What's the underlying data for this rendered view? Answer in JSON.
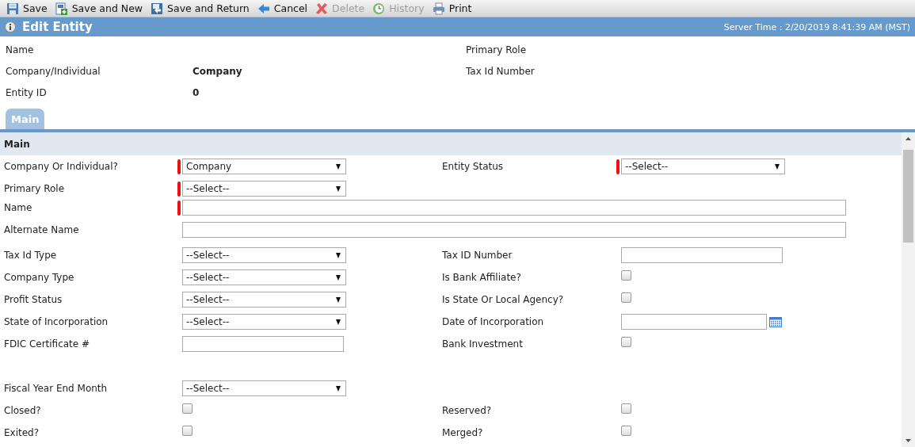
{
  "toolbar": [
    {
      "label": "Save",
      "kind": "save",
      "disabled": false
    },
    {
      "label": "Save and New",
      "kind": "savenew",
      "disabled": false
    },
    {
      "label": "Save and Return",
      "kind": "savereturn",
      "disabled": false
    },
    {
      "label": "Cancel",
      "kind": "cancel",
      "disabled": false
    },
    {
      "label": "Delete",
      "kind": "delete",
      "disabled": true
    },
    {
      "label": "History",
      "kind": "history",
      "disabled": true
    },
    {
      "label": "Print",
      "kind": "print",
      "disabled": false
    }
  ],
  "header": {
    "title": "Edit Entity",
    "server_time": "Server Time : 2/20/2019 8:41:39 AM (MST)"
  },
  "summary": [
    {
      "left": {
        "label": "Name"
      },
      "right": {
        "label": "Primary Role"
      }
    },
    {
      "left": {
        "label": "Company/Individual",
        "value": "Company"
      },
      "right": {
        "label": "Tax Id Number"
      }
    },
    {
      "left": {
        "label": "Entity ID",
        "value": "0"
      }
    }
  ],
  "tabs": [
    {
      "label": "Main",
      "selected": true
    }
  ],
  "section": {
    "title": "Main",
    "rows": [
      {
        "left": {
          "label": "Company Or Individual?",
          "kind": "select",
          "value": "Company",
          "required": true
        },
        "right": {
          "label": "Entity Status",
          "kind": "select",
          "value": "--Select--",
          "required": true
        }
      },
      {
        "left": {
          "label": "Primary Role",
          "kind": "select",
          "value": "--Select--",
          "required": true
        }
      },
      {
        "left": {
          "label": "Name",
          "kind": "wide-text",
          "required": true
        }
      },
      {
        "left": {
          "label": "Alternate Name",
          "kind": "wide-text",
          "required": false
        }
      },
      {
        "left": {
          "label": "Tax Id Type",
          "kind": "select",
          "value": "--Select--",
          "required": false
        },
        "right": {
          "label": "Tax ID Number",
          "kind": "text",
          "required": false
        }
      },
      {
        "left": {
          "label": "Company Type",
          "kind": "select",
          "value": "--Select--",
          "required": false
        },
        "right": {
          "label": "Is Bank Affiliate?",
          "kind": "checkbox",
          "checked": false,
          "required": false
        }
      },
      {
        "left": {
          "label": "Profit Status",
          "kind": "select",
          "value": "--Select--",
          "required": false
        },
        "right": {
          "label": "Is State Or Local Agency?",
          "kind": "checkbox",
          "checked": false,
          "required": false
        }
      },
      {
        "left": {
          "label": "State of Incorporation",
          "kind": "select",
          "value": "--Select--",
          "required": false
        },
        "right": {
          "label": "Date of Incorporation",
          "kind": "date",
          "required": false
        }
      },
      {
        "left": {
          "label": "FDIC Certificate #",
          "kind": "text",
          "required": false
        },
        "right": {
          "label": "Bank Investment",
          "kind": "checkbox",
          "checked": false,
          "required": false
        }
      },
      {
        "kind": "spacer"
      },
      {
        "left": {
          "label": "Fiscal Year End Month",
          "kind": "select",
          "value": "--Select--",
          "required": false
        }
      },
      {
        "left": {
          "label": "Closed?",
          "kind": "checkbox",
          "checked": false,
          "required": false
        },
        "right": {
          "label": "Reserved?",
          "kind": "checkbox",
          "checked": false,
          "required": false
        }
      },
      {
        "left": {
          "label": "Exited?",
          "kind": "checkbox",
          "checked": false,
          "required": false
        },
        "right": {
          "label": "Merged?",
          "kind": "checkbox",
          "checked": false,
          "required": false
        }
      }
    ]
  }
}
